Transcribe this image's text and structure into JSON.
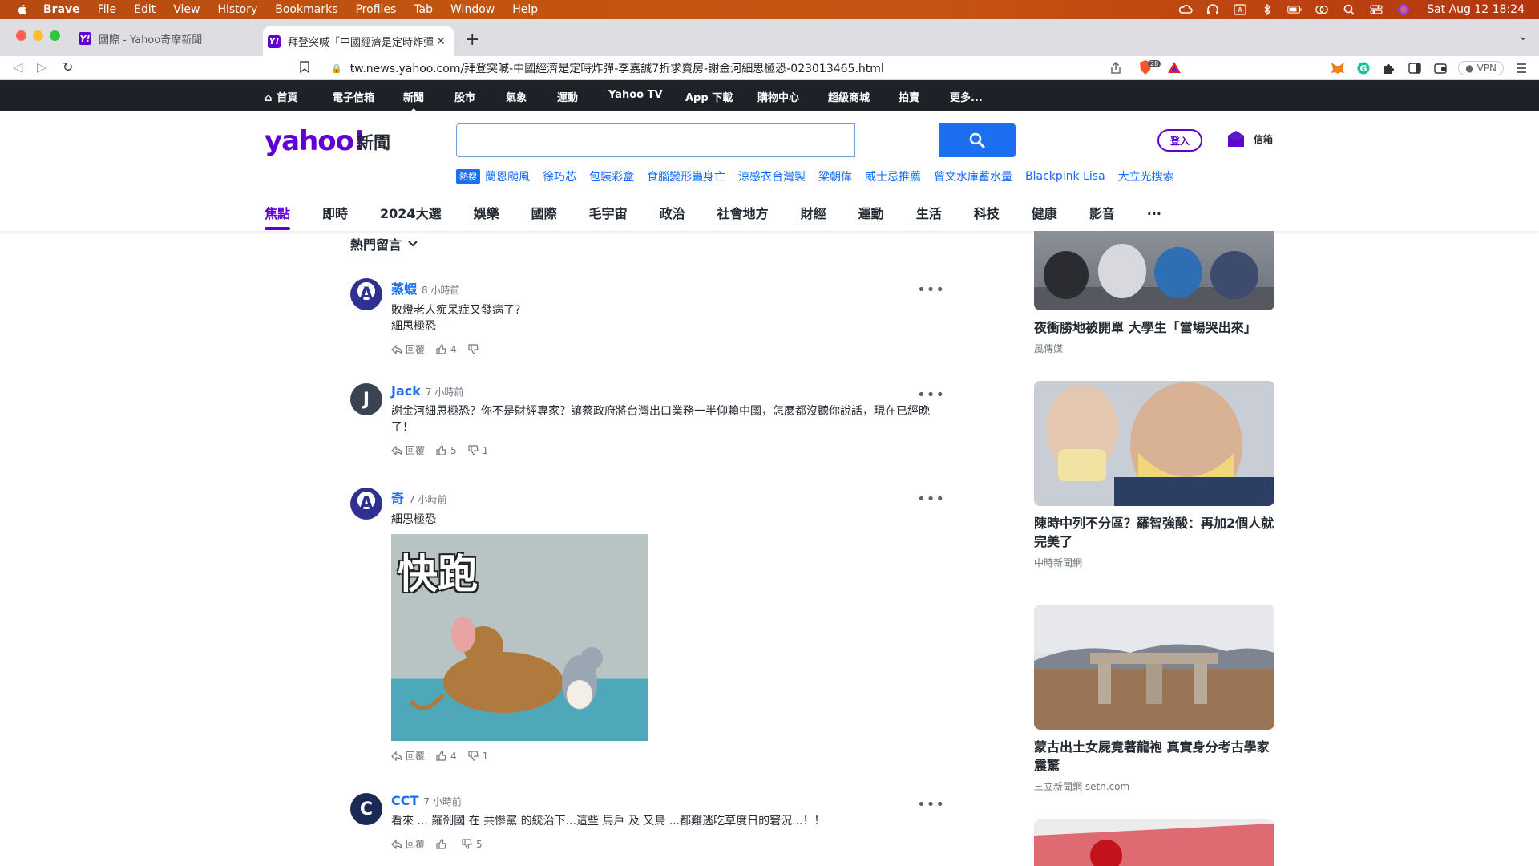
{
  "menubar": {
    "app": "Brave",
    "items": [
      "File",
      "Edit",
      "View",
      "History",
      "Bookmarks",
      "Profiles",
      "Tab",
      "Window",
      "Help"
    ],
    "clock": "Sat Aug 12  18:24"
  },
  "tabs": [
    {
      "title": "國際 - Yahoo奇摩新聞"
    },
    {
      "title": "拜登突喊「中國經濟是定時炸彈」"
    }
  ],
  "address": {
    "url": "tw.news.yahoo.com/拜登突喊-中國經濟是定時炸彈-李嘉誠7折求賣房-謝金河細思極恐-023013465.html",
    "shield_count": "28",
    "vpn": "VPN"
  },
  "ytop": {
    "items": [
      "首頁",
      "電子信箱",
      "新聞",
      "股市",
      "氣象",
      "運動",
      "Yahoo TV",
      "App 下載",
      "購物中心",
      "超級商城",
      "拍賣",
      "更多..."
    ],
    "active_index": 2
  },
  "header": {
    "logo": "yahoo!",
    "logo_sub": "新聞",
    "search_placeholder": "",
    "login": "登入",
    "mail": "信箱",
    "hot_label": "熱搜",
    "trending": [
      "蘭恩颱風",
      "徐巧芯",
      "包裝彩盒",
      "食腦變形蟲身亡",
      "涼感衣台灣製",
      "梁朝偉",
      "威士忌推薦",
      "曾文水庫蓄水量",
      "Blackpink Lisa",
      "大立光搜索"
    ],
    "categories": [
      "焦點",
      "即時",
      "2024大選",
      "娛樂",
      "國際",
      "毛宇宙",
      "政治",
      "社會地方",
      "財經",
      "運動",
      "生活",
      "科技",
      "健康",
      "影音",
      "..."
    ],
    "active_category": 0
  },
  "comments_header": "熱門留言",
  "comments": [
    {
      "name": "蒸蝦",
      "time": "8 小時前",
      "lines": [
        "敗燈老人痴呆症又發病了?",
        "細思極恐"
      ],
      "reply": "回覆",
      "likes": "4",
      "dislikes": ""
    },
    {
      "name": "Jack",
      "time": "7 小時前",
      "lines": [
        "謝金河細思極恐？你不是財經專家？讓蔡政府將台灣出口業務一半仰賴中國，怎麼都沒聽你說話，現在已經晚",
        "了！"
      ],
      "reply": "回覆",
      "likes": "5",
      "dislikes": "1"
    },
    {
      "name": "奇",
      "time": "7 小時前",
      "lines": [
        "細思極恐"
      ],
      "gif_text": "快跑",
      "reply": "回覆",
      "likes": "4",
      "dislikes": "1"
    },
    {
      "name": "CCT",
      "time": "7 小時前",
      "lines": [
        "看來 ... 羅剎國 在 共慘黨 的統治下...這些 馬戶 及 又鳥 ...都難逃吃草度日的窘況...！！"
      ],
      "reply": "回覆",
      "likes": "",
      "dislikes": "5"
    }
  ],
  "rail": [
    {
      "title": "夜衝勝地被開單 大學生「當場哭出來」",
      "source": "風傳媒"
    },
    {
      "title": "陳時中列不分區？羅智強酸：再加2個人就完美了",
      "source": "中時新聞網"
    },
    {
      "title": "蒙古出土女屍竟著龍袍 真實身分考古學家震驚",
      "source": "三立新聞網 setn.com"
    }
  ]
}
